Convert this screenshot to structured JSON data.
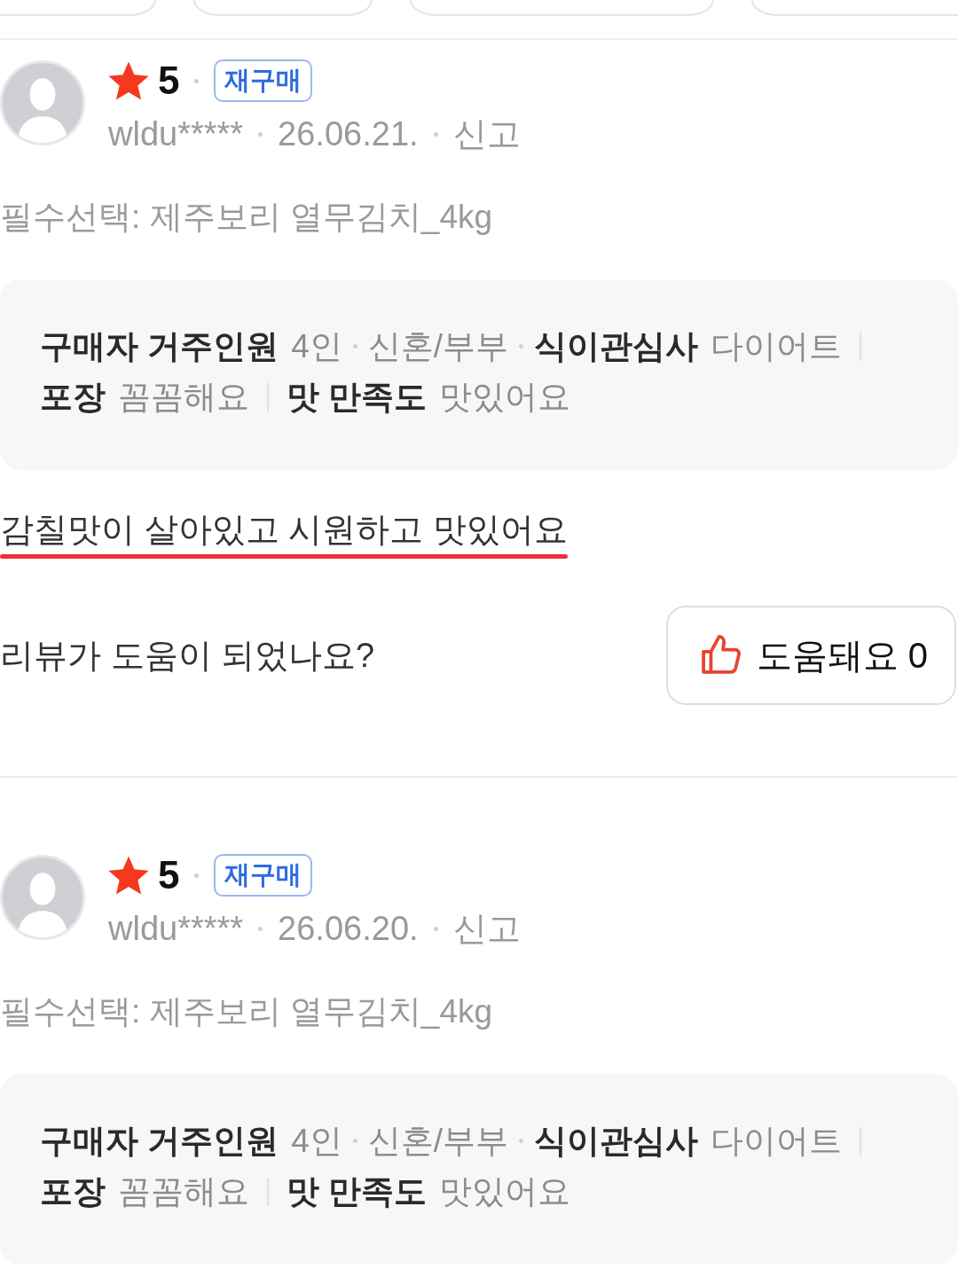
{
  "reviews": [
    {
      "rating": "5",
      "badge": "재구매",
      "user": "wldu*****",
      "date": "26.06.21.",
      "report": "신고",
      "option": "필수선택: 제주보리 열무김치_4kg",
      "survey": [
        [
          {
            "label": "구매자 거주인원",
            "values": [
              "4인",
              "신혼/부부"
            ]
          },
          {
            "label": "식이관심사",
            "values": [
              "다이어트"
            ]
          }
        ],
        [
          {
            "label": "포장",
            "values": [
              "꼼꼼해요"
            ]
          }
        ],
        [
          {
            "label": "맛 만족도",
            "values": [
              "맛있어요"
            ]
          }
        ]
      ],
      "text": "감칠맛이 살아있고 시원하고 맛있어요",
      "underlined": true,
      "helpful": {
        "question": "리뷰가 도움이 되었나요?",
        "button": "도움돼요 0"
      }
    },
    {
      "rating": "5",
      "badge": "재구매",
      "user": "wldu*****",
      "date": "26.06.20.",
      "report": "신고",
      "option": "필수선택: 제주보리 열무김치_4kg",
      "survey": [
        [
          {
            "label": "구매자 거주인원",
            "values": [
              "4인",
              "신혼/부부"
            ]
          },
          {
            "label": "식이관심사",
            "values": [
              "다이어트"
            ]
          }
        ],
        [
          {
            "label": "포장",
            "values": [
              "꼼꼼해요"
            ]
          }
        ],
        [
          {
            "label": "맛 만족도",
            "values": [
              "맛있어요"
            ]
          }
        ]
      ]
    }
  ]
}
